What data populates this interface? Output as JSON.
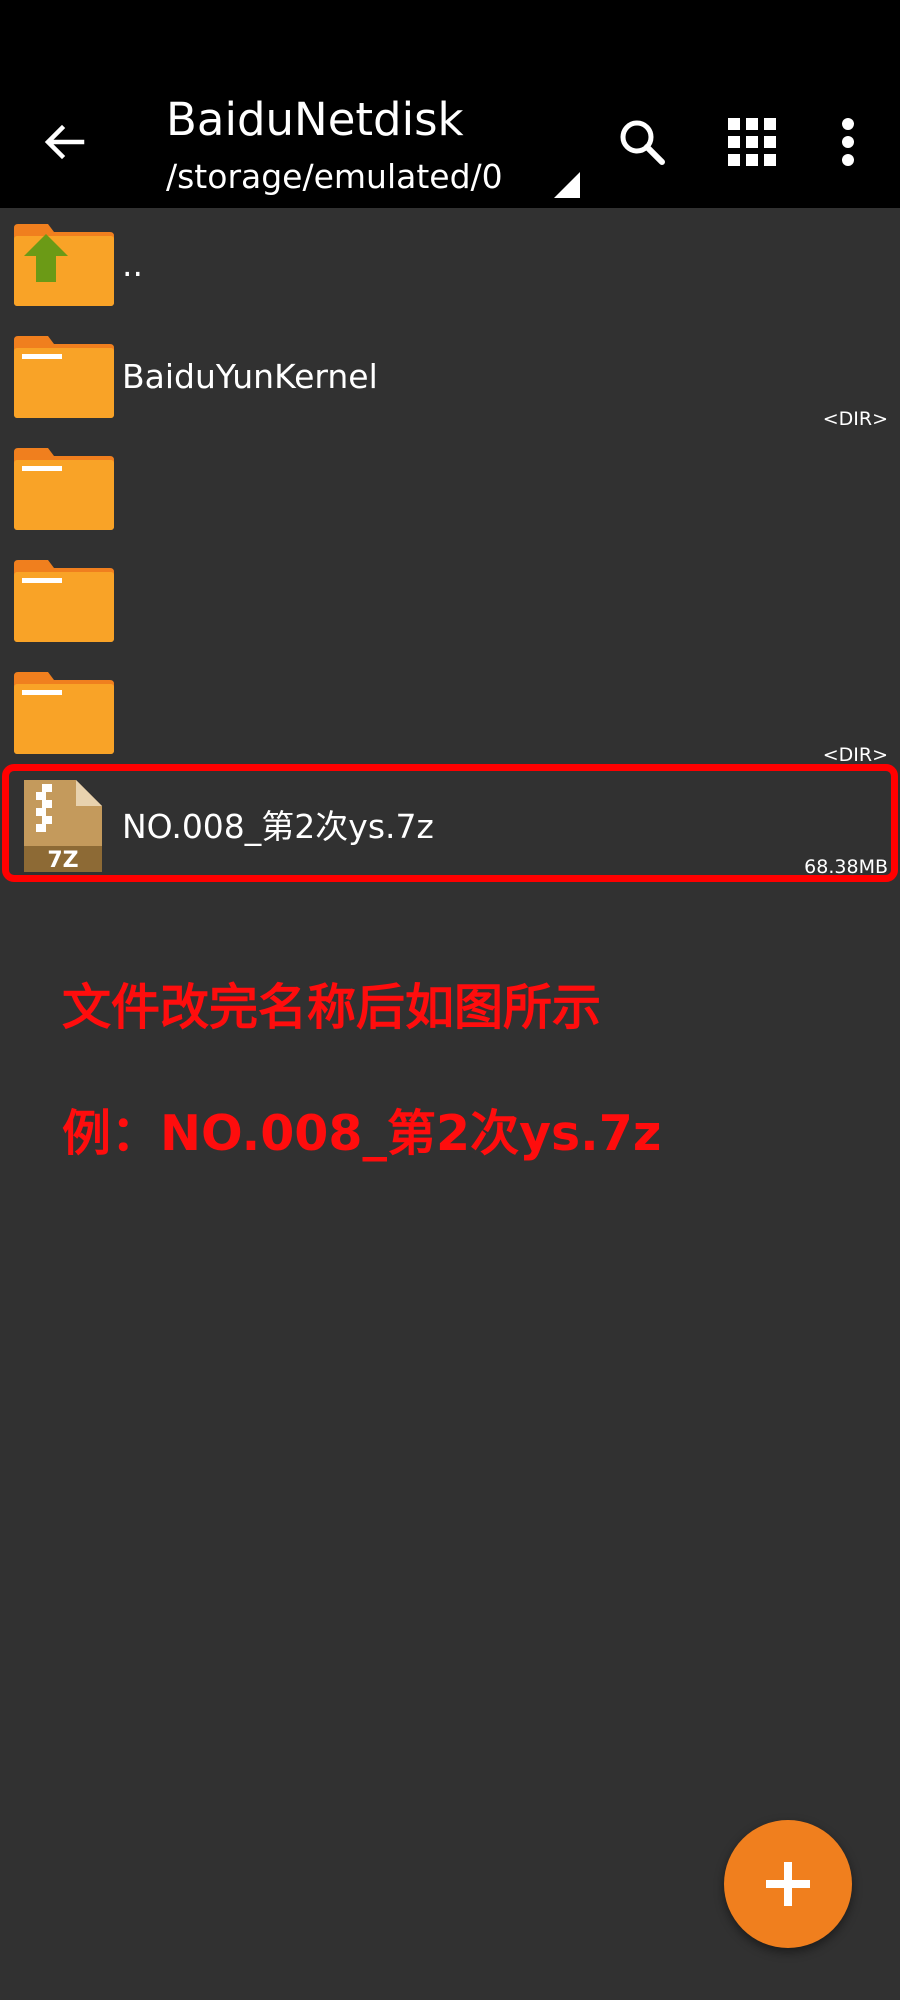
{
  "toolbar": {
    "title": "BaiduNetdisk",
    "path": "/storage/emulated/0",
    "back_icon": "arrow-left-icon",
    "search_icon": "search-icon",
    "grid_icon": "grid-view-icon",
    "more_icon": "more-vert-icon"
  },
  "files": [
    {
      "name": "..",
      "meta": "",
      "icon": "folder-up-icon"
    },
    {
      "name": "BaiduYunKernel",
      "meta": "<DIR>",
      "icon": "folder-icon"
    },
    {
      "name": "",
      "meta": "",
      "icon": "folder-icon"
    },
    {
      "name": "",
      "meta": "",
      "icon": "folder-icon"
    },
    {
      "name": "",
      "meta": "<DIR>",
      "icon": "folder-icon"
    },
    {
      "name": "NO.008_第2次ys.7z",
      "meta": "68.38MB",
      "icon": "archive-7z-icon",
      "icon_label": "7Z"
    }
  ],
  "annotation": {
    "line1": "文件改完名称后如图所示",
    "line2": "例：NO.008_第2次ys.7z"
  },
  "fab": {
    "icon": "plus-icon"
  },
  "colors": {
    "background": "#313131",
    "toolbar": "#000000",
    "folder": "#f9a327",
    "accent": "#f07f1e",
    "highlight": "#ff0000",
    "annotation": "#ff0d0d"
  }
}
